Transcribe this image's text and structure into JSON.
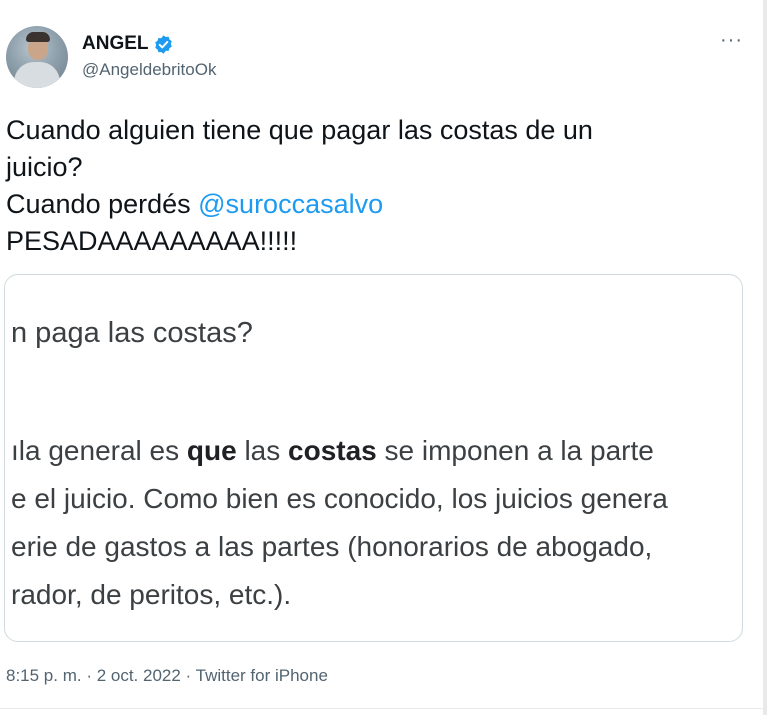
{
  "author": {
    "display_name": "ANGEL",
    "handle": "@AngeldebritoOk",
    "verified": true
  },
  "more_options_glyph": "···",
  "tweet_text": {
    "line1": "Cuando alguien tiene que pagar las costas de un",
    "line2": "juicio?",
    "line3_prefix": "Cuando perdés ",
    "mention": "@suroccasalvo",
    "line4": "PESADAAAAAAAAA!!!!!"
  },
  "media_card": {
    "question": "n paga las costas?",
    "para": [
      {
        "pre": "ıla general es ",
        "b1": "que",
        "mid": " las ",
        "b2": "costas",
        "post": " se imponen a la parte"
      },
      {
        "text": "e el juicio. Como bien es conocido, los juicios genera"
      },
      {
        "text": "erie de gastos a las partes (honorarios de abogado,"
      },
      {
        "text": "rador, de peritos, etc.)."
      }
    ]
  },
  "meta": {
    "timestamp": "8:15 p. m. · 2 oct. 2022",
    "separator": " · ",
    "source": "Twitter for iPhone"
  },
  "colors": {
    "mention": "#1d9bf0",
    "verified_badge": "#1d9bf0",
    "secondary_text": "#536471"
  }
}
